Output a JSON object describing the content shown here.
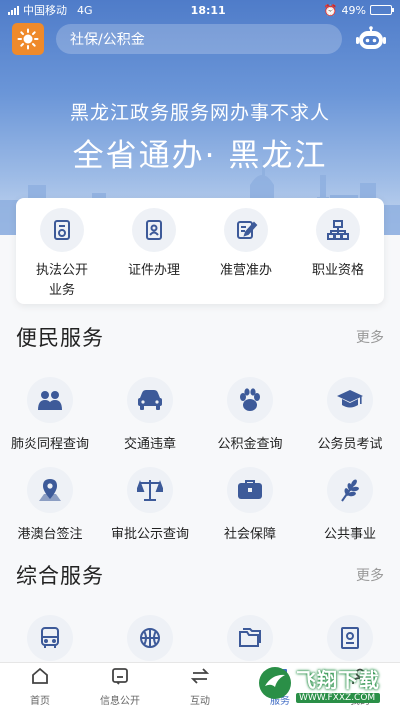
{
  "status_bar": {
    "carrier": "中国移动",
    "network": "4G",
    "time": "18:11",
    "battery": "49%",
    "battery_level": 0.49
  },
  "header": {
    "search_text": "社保/公积金"
  },
  "hero": {
    "slogan_line1": "黑龙江政务服务网办事不求人",
    "slogan_line2": "全省通办· 黑龙江"
  },
  "quick_services": [
    {
      "label": "执法公开业务",
      "icon": "document-stamp-icon"
    },
    {
      "label": "证件办理",
      "icon": "id-card-icon"
    },
    {
      "label": "准营准办",
      "icon": "edit-document-icon"
    },
    {
      "label": "职业资格",
      "icon": "org-chart-icon"
    }
  ],
  "convenience": {
    "title": "便民服务",
    "more": "更多",
    "items": [
      {
        "label": "肺炎同程查询",
        "icon": "group-people-icon"
      },
      {
        "label": "交通违章",
        "icon": "car-icon"
      },
      {
        "label": "公积金查询",
        "icon": "paw-icon"
      },
      {
        "label": "公务员考试",
        "icon": "graduation-cap-icon"
      },
      {
        "label": "港澳台签注",
        "icon": "map-pin-icon"
      },
      {
        "label": "审批公示查询",
        "icon": "scales-icon"
      },
      {
        "label": "社会保障",
        "icon": "briefcase-icon"
      },
      {
        "label": "公共事业",
        "icon": "wheat-icon"
      }
    ]
  },
  "comprehensive": {
    "title": "综合服务",
    "more": "更多",
    "items": [
      {
        "label": "",
        "icon": "bus-icon"
      },
      {
        "label": "",
        "icon": "basketball-icon"
      },
      {
        "label": "",
        "icon": "folder-icon"
      },
      {
        "label": "",
        "icon": "certificate-icon"
      }
    ]
  },
  "tabbar": [
    {
      "label": "首页",
      "icon": "home-icon"
    },
    {
      "label": "信息公开",
      "icon": "info-icon"
    },
    {
      "label": "互动",
      "icon": "exchange-icon"
    },
    {
      "label": "服务",
      "icon": "service-icon",
      "active": true
    },
    {
      "label": "我的",
      "icon": "user-icon"
    }
  ],
  "watermark": {
    "big": "飞翔下载",
    "small": "WWW.FXXZ.COM"
  },
  "colors": {
    "accent": "#3f6bc4",
    "icon_blue": "#3d5a99",
    "logo_orange": "#ef8a2b"
  }
}
